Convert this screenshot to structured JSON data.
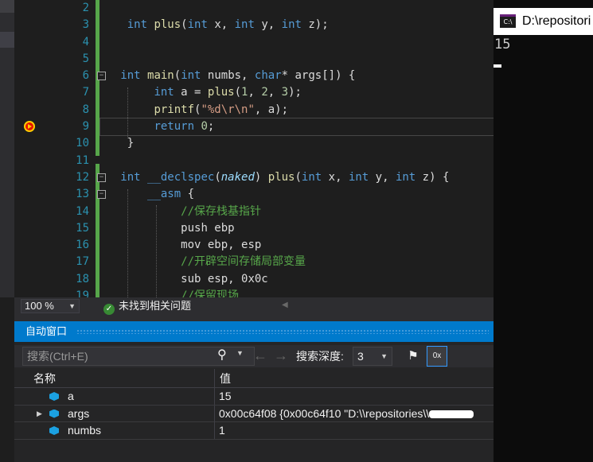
{
  "editor": {
    "lines": [
      {
        "n": "2"
      },
      {
        "n": "3"
      },
      {
        "n": "4"
      },
      {
        "n": "5"
      },
      {
        "n": "6"
      },
      {
        "n": "7"
      },
      {
        "n": "8"
      },
      {
        "n": "9"
      },
      {
        "n": "10"
      },
      {
        "n": "11"
      },
      {
        "n": "12"
      },
      {
        "n": "13"
      },
      {
        "n": "14"
      },
      {
        "n": "15"
      },
      {
        "n": "16"
      },
      {
        "n": "17"
      },
      {
        "n": "18"
      },
      {
        "n": "19"
      }
    ],
    "code": {
      "l3_int": "int",
      "l3_name": "plus",
      "l3_rest_a": "(",
      "l3_int2": "int",
      "l3_x": " x, ",
      "l3_int3": "int",
      "l3_y": " y, ",
      "l3_int4": "int",
      "l3_z": " z);",
      "l6_int": "int",
      "l6_main": " main",
      "l6_p1": "(",
      "l6_int2": "int",
      "l6_numbs": " numbs, ",
      "l6_char": "char",
      "l6_rest": "* args[]) {",
      "l7_int": "int",
      "l7_a": " a = ",
      "l7_plus": "plus",
      "l7_args_a": "(",
      "l7_1": "1",
      "l7_c1": ", ",
      "l7_2": "2",
      "l7_c2": ", ",
      "l7_3": "3",
      "l7_end": ");",
      "l8_printf": "printf",
      "l8_p": "(",
      "l8_str": "\"%d\\r\\n\"",
      "l8_end": ", a);",
      "l9_return": "return",
      "l9_sp": " ",
      "l9_0": "0",
      "l9_end": ";",
      "l10": "}",
      "l12_int": "int",
      "l12_decl": " __declspec",
      "l12_p1": "(",
      "l12_naked": "naked",
      "l12_p2": ") ",
      "l12_plus": "plus",
      "l12_p3": "(",
      "l12_int2": "int",
      "l12_x": " x, ",
      "l12_int3": "int",
      "l12_y": " y, ",
      "l12_int4": "int",
      "l12_z": " z) {",
      "l13_asm": "__asm",
      "l13_brace": " {",
      "l14": "//保存栈基指针",
      "l15": "push ebp",
      "l16": "mov ebp, esp",
      "l17": "//开辟空间存储局部变量",
      "l18": "sub esp, 0x0c",
      "l19": "//保留现场"
    }
  },
  "status": {
    "zoom": "100 %",
    "issues": "未找到相关问题",
    "ok_glyph": "✓"
  },
  "autos": {
    "title": "自动窗口",
    "search_placeholder": "搜索(Ctrl+E)",
    "depth_label": "搜索深度:",
    "depth_value": "3",
    "col_name": "名称",
    "col_value": "值",
    "rows": [
      {
        "name": "a",
        "value": "15"
      },
      {
        "name": "args",
        "value": "0x00c64f08 {0x00c64f10 \"D:\\\\repositories\\\\"
      },
      {
        "name": "numbs",
        "value": "1"
      }
    ]
  },
  "console": {
    "title": "D:\\repositori",
    "icon_text": "C:\\",
    "output": "15"
  },
  "colors": {
    "accent": "#007acc",
    "keyword": "#569cd6",
    "comment": "#57a64a",
    "breakpoint": "#e51400"
  }
}
